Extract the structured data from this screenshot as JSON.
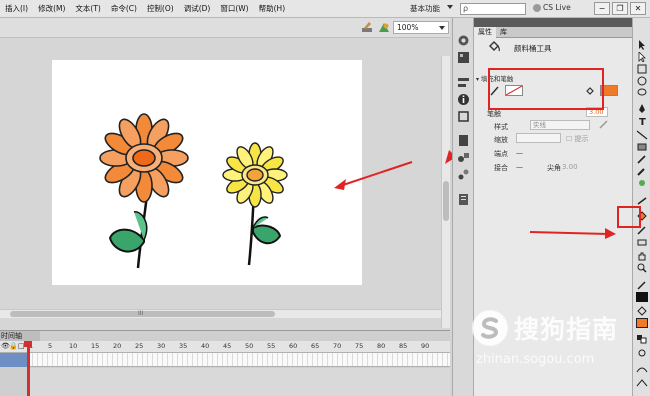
{
  "menu": {
    "items": [
      "插入(I)",
      "修改(M)",
      "文本(T)",
      "命令(C)",
      "控制(O)",
      "调试(D)",
      "窗口(W)",
      "帮助(H)"
    ],
    "workspace": "基本功能",
    "search_value": "ρ",
    "cs_live": "CS Live",
    "win_min": "−",
    "win_restore": "❐",
    "win_close": "✕"
  },
  "stage": {
    "zoom": "100%",
    "hscroll_grip": "III"
  },
  "timeline": {
    "tab_label": "时间轴",
    "ruler": [
      "1",
      "5",
      "10",
      "15",
      "20",
      "25",
      "30",
      "35",
      "40",
      "45",
      "50",
      "55",
      "60",
      "65",
      "70",
      "75",
      "80",
      "85",
      "90"
    ],
    "icons": [
      "👁",
      "🔒",
      "□"
    ]
  },
  "properties": {
    "tabs": [
      "属性",
      "库"
    ],
    "tool_name": "颜料桶工具",
    "section_title": "填充和笔触",
    "stroke_label": "笔触",
    "stroke_value": "3.00",
    "style_label": "样式",
    "style_value": "实线",
    "scale_label": "缩放",
    "hint_label": "提示",
    "cap_label": "端点",
    "cap_value": "—",
    "join_label": "接合",
    "join_value": "—",
    "miter_label": "尖角",
    "miter_value": "3.00"
  },
  "watermark": {
    "brand": "搜狗指南",
    "url": "zhinan.sogou.com"
  },
  "colors": {
    "fill": "#f07a28",
    "highlight": "#e02424"
  }
}
